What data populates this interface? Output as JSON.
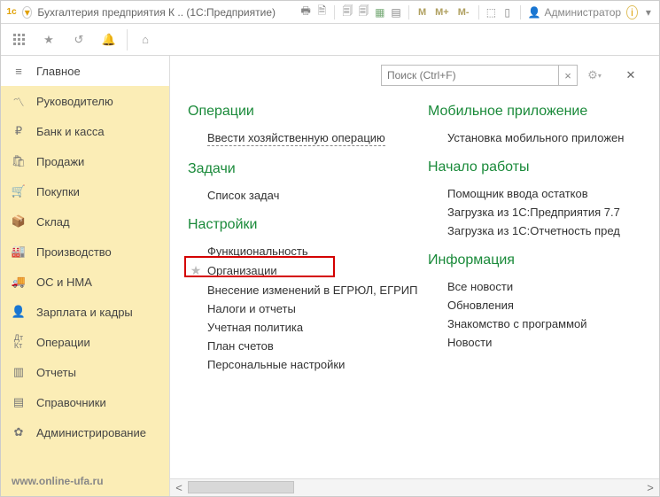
{
  "title": "Бухгалтерия предприятия К .. (1С:Предприятие)",
  "m_buttons": [
    "M",
    "M+",
    "M-"
  ],
  "user": "Администратор",
  "search_placeholder": "Поиск (Ctrl+F)",
  "sidebar": {
    "items": [
      {
        "label": "Главное"
      },
      {
        "label": "Руководителю"
      },
      {
        "label": "Банк и касса"
      },
      {
        "label": "Продажи"
      },
      {
        "label": "Покупки"
      },
      {
        "label": "Склад"
      },
      {
        "label": "Производство"
      },
      {
        "label": "ОС и НМА"
      },
      {
        "label": "Зарплата и кадры"
      },
      {
        "label": "Операции"
      },
      {
        "label": "Отчеты"
      },
      {
        "label": "Справочники"
      },
      {
        "label": "Администрирование"
      }
    ],
    "footer": "www.online-ufa.ru"
  },
  "panel": {
    "left": {
      "sections": [
        {
          "title": "Операции",
          "links": [
            {
              "label": "Ввести хозяйственную операцию",
              "dashed": true
            }
          ]
        },
        {
          "title": "Задачи",
          "links": [
            {
              "label": "Список задач"
            }
          ]
        },
        {
          "title": "Настройки",
          "links": [
            {
              "label": "Функциональность"
            },
            {
              "label": "Организации",
              "star": true,
              "hl": true
            },
            {
              "label": "Внесение изменений в ЕГРЮЛ, ЕГРИП"
            },
            {
              "label": "Налоги и отчеты"
            },
            {
              "label": "Учетная политика"
            },
            {
              "label": "План счетов"
            },
            {
              "label": "Персональные настройки"
            }
          ]
        }
      ]
    },
    "right": {
      "sections": [
        {
          "title": "Мобильное приложение",
          "links": [
            {
              "label": "Установка мобильного приложен"
            }
          ]
        },
        {
          "title": "Начало работы",
          "links": [
            {
              "label": "Помощник ввода остатков"
            },
            {
              "label": "Загрузка из 1С:Предприятия 7.7"
            },
            {
              "label": "Загрузка из 1С:Отчетность пред"
            }
          ]
        },
        {
          "title": "Информация",
          "links": [
            {
              "label": "Все новости"
            },
            {
              "label": "Обновления"
            },
            {
              "label": "Знакомство с программой"
            },
            {
              "label": "Новости"
            }
          ]
        }
      ]
    }
  }
}
